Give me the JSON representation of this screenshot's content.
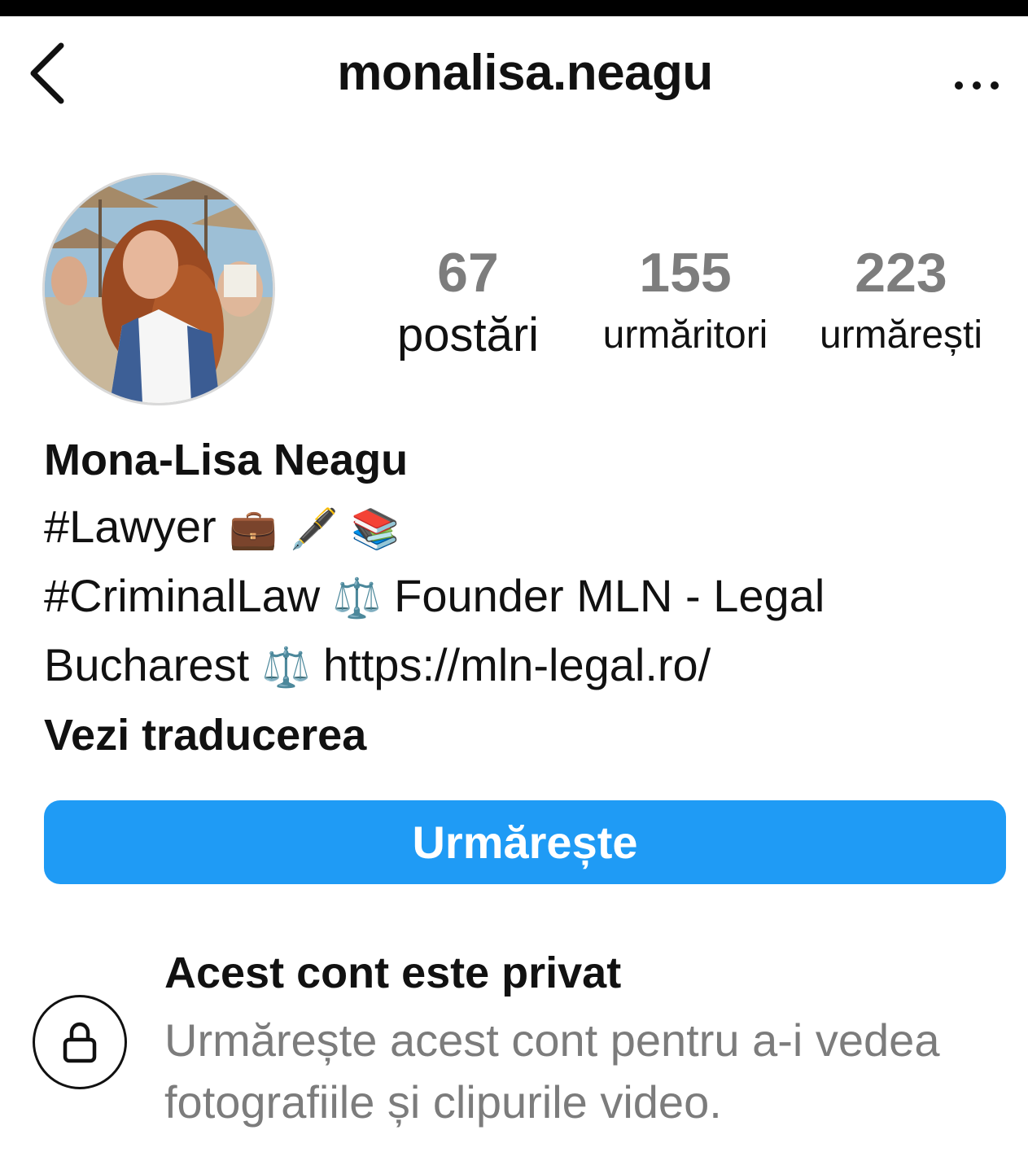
{
  "header": {
    "title": "monalisa.neagu",
    "back_icon": "chevron-left-icon",
    "more_icon": "more-horizontal-icon"
  },
  "profile": {
    "avatar_icon": "profile-photo",
    "stats": [
      {
        "value": "67",
        "label": "postări"
      },
      {
        "value": "155",
        "label": "urmăritori"
      },
      {
        "value": "223",
        "label": "urmărești"
      }
    ],
    "name": "Mona-Lisa Neagu",
    "bio": {
      "line1_text": "#Lawyer",
      "line1_emojis": "💼 🖋️ 📚",
      "line2_hashtag": "#CriminalLaw",
      "line2_rest": "Founder MLN - Legal",
      "line3_text": "Bucharest",
      "line3_link": "https://mln-legal.ro/",
      "scales_emoji": "⚖️"
    },
    "translate_label": "Vezi traducerea"
  },
  "actions": {
    "follow_label": "Urmărește",
    "follow_color": "#1f9bf5"
  },
  "private": {
    "icon": "lock-icon",
    "title": "Acest cont este privat",
    "description": "Urmărește acest cont pentru a-i vedea fotografiile și clipurile video."
  }
}
